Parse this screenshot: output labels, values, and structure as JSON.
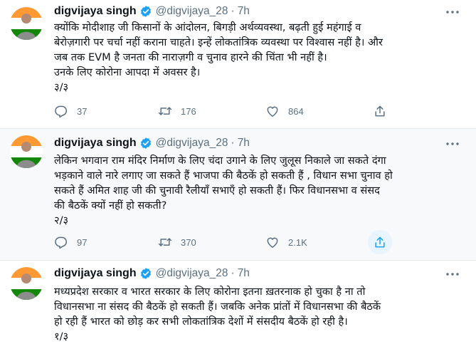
{
  "tweets": [
    {
      "name": "digvijaya singh",
      "handle": "@digvijaya_28",
      "sep": "·",
      "time": "7h",
      "lines": [
        "क्योंकि मोदीशाह जी किसानों के आंदोलन,   बिगड़ी अर्थव्यवस्था, बढ़ती हुई महंगाई व",
        "बेरोज़गारी पर चर्चा नहीं कराना चाहते। इन्हें लोकतांत्रिक व्यवस्था पर विश्वास नहीं है। और",
        "जब तक EVM है जनता की नाराज़गी व चुनाव हारने की चिंता भी नहीं है।",
        "उनके लिए कोरोना आपदा में अवसर है।",
        "३/३"
      ],
      "replies": "37",
      "retweets": "176",
      "likes": "864"
    },
    {
      "name": "digvijaya singh",
      "handle": "@digvijaya_28",
      "sep": "·",
      "time": "7h",
      "lines": [
        "लेकिन भगवान राम मंदिर निर्माण के लिए चंदा उगाने के लिए जुलूस निकाले जा सकते दंगा",
        "भड़काने वाले नारे लगाए जा सकते हैं भाजपा की बैठकें हो सकती हैं , विधान सभा चुनाव हो",
        "सकते हैं अमित शाह जी की चुनावी रैलीयाँ सभाएँ हो सकती हैं। फिर विधानसभा व संसद",
        "की बैठकें क्यों नहीं हो सकती?",
        "२/३"
      ],
      "replies": "97",
      "retweets": "370",
      "likes": "2.1K"
    },
    {
      "name": "digvijaya singh",
      "handle": "@digvijaya_28",
      "sep": "·",
      "time": "7h",
      "lines": [
        "मध्यप्रदेश सरकार व भारत सरकार के लिए कोरोना इतना ख़तरनाक हो चुका है ना तो",
        "विधानसभा ना संसद की बैठकें हो सकती हैं। जबकि अनेक प्रांतों में विधानसभा की बैठकें",
        "हो रही हैं भारत को छोड़ कर सभी लोकतांत्रिक देशों में संसदीय बैठकें हो रही है।",
        "१/३"
      ]
    }
  ],
  "colors": {
    "verified": "#1da1f2",
    "secondary_text": "#5b7083",
    "divider": "#e6ecf0",
    "share_highlight": "#e8f5fe"
  },
  "icons": [
    "verified-badge-icon",
    "more-options-icon",
    "reply-icon",
    "retweet-icon",
    "like-icon",
    "share-icon"
  ]
}
